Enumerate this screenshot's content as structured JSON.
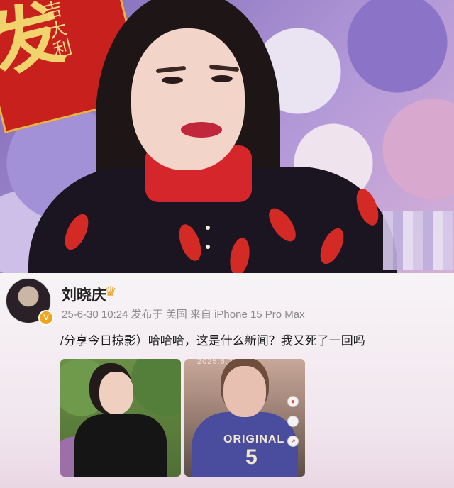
{
  "post": {
    "username": "刘晓庆",
    "meta": "25-6-30 10:24  发布于 美国  来自 iPhone 15 Pro Max",
    "text": "/分享今日掠影）哈哈哈，这是什么新闻？我又死了一回吗",
    "verified_badge": "V"
  },
  "hero": {
    "banner_char": "发",
    "banner_small": "大吉大利",
    "photo2_print": "ORIGINAL",
    "photo2_number": "5",
    "photo2_caption": "2025.6.28"
  },
  "icons": [
    "crown-icon",
    "verified-icon"
  ],
  "colors": {
    "accent_red": "#d32a26",
    "crown": "#e9a42a",
    "meta_text": "#8a8a8a"
  }
}
